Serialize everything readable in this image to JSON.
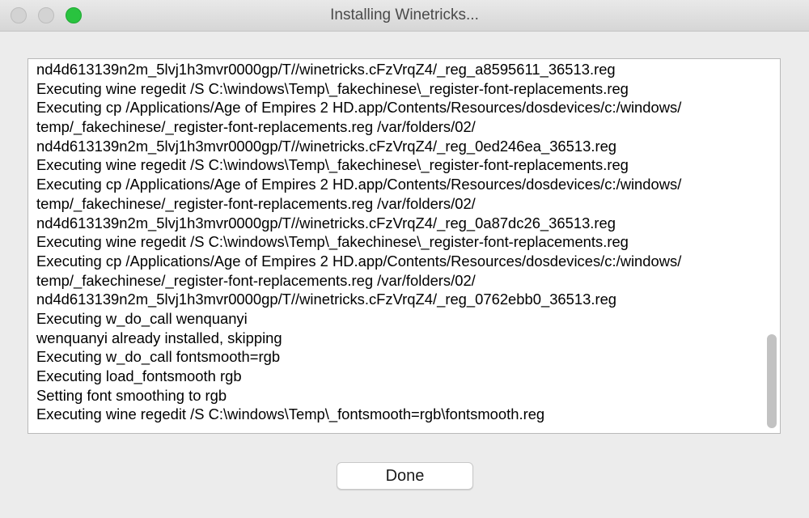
{
  "window": {
    "title": "Installing Winetricks..."
  },
  "log": {
    "lines": [
      "nd4d613139n2m_5lvj1h3mvr0000gp/T//winetricks.cFzVrqZ4/_reg_a8595611_36513.reg",
      "Executing wine regedit /S C:\\windows\\Temp\\_fakechinese\\_register-font-replacements.reg",
      "Executing cp /Applications/Age of Empires 2 HD.app/Contents/Resources/dosdevices/c:/windows/",
      "temp/_fakechinese/_register-font-replacements.reg /var/folders/02/",
      "nd4d613139n2m_5lvj1h3mvr0000gp/T//winetricks.cFzVrqZ4/_reg_0ed246ea_36513.reg",
      "Executing wine regedit /S C:\\windows\\Temp\\_fakechinese\\_register-font-replacements.reg",
      "Executing cp /Applications/Age of Empires 2 HD.app/Contents/Resources/dosdevices/c:/windows/",
      "temp/_fakechinese/_register-font-replacements.reg /var/folders/02/",
      "nd4d613139n2m_5lvj1h3mvr0000gp/T//winetricks.cFzVrqZ4/_reg_0a87dc26_36513.reg",
      "Executing wine regedit /S C:\\windows\\Temp\\_fakechinese\\_register-font-replacements.reg",
      "Executing cp /Applications/Age of Empires 2 HD.app/Contents/Resources/dosdevices/c:/windows/",
      "temp/_fakechinese/_register-font-replacements.reg /var/folders/02/",
      "nd4d613139n2m_5lvj1h3mvr0000gp/T//winetricks.cFzVrqZ4/_reg_0762ebb0_36513.reg",
      "Executing w_do_call wenquanyi",
      "wenquanyi already installed, skipping",
      "Executing w_do_call fontsmooth=rgb",
      "Executing load_fontsmooth rgb",
      "Setting font smoothing to rgb",
      "Executing wine regedit /S C:\\windows\\Temp\\_fontsmooth=rgb\\fontsmooth.reg"
    ]
  },
  "actions": {
    "done_label": "Done"
  },
  "colors": {
    "zoom_button": "#29c33f",
    "background": "#ececec"
  }
}
